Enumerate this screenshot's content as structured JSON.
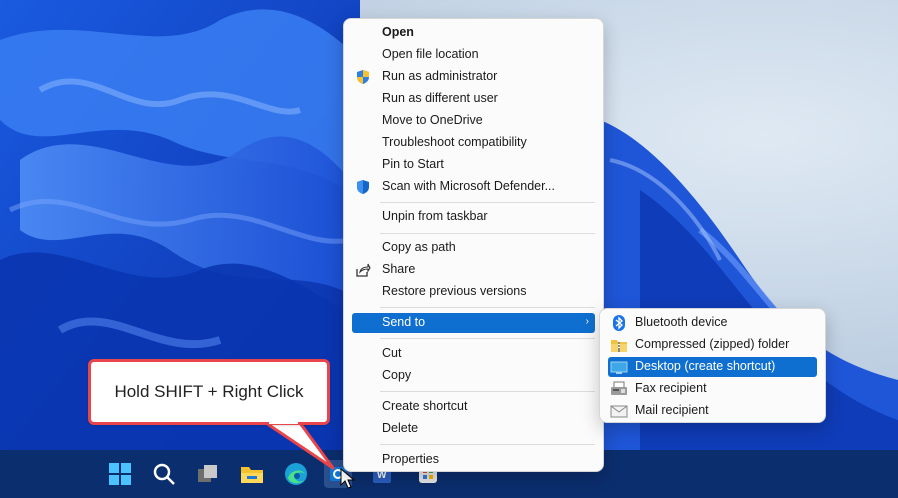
{
  "callout": {
    "text": "Hold SHIFT + Right Click"
  },
  "context_menu": {
    "items": [
      {
        "label": "Open",
        "icon": ""
      },
      {
        "label": "Open file location",
        "icon": ""
      },
      {
        "label": "Run as administrator",
        "icon": "uac-shield-icon"
      },
      {
        "label": "Run as different user",
        "icon": ""
      },
      {
        "label": "Move to OneDrive",
        "icon": ""
      },
      {
        "label": "Troubleshoot compatibility",
        "icon": ""
      },
      {
        "label": "Pin to Start",
        "icon": ""
      },
      {
        "label": "Scan with Microsoft Defender...",
        "icon": "defender-shield-icon"
      },
      {
        "label": "Unpin from taskbar",
        "icon": ""
      },
      {
        "label": "Copy as path",
        "icon": ""
      },
      {
        "label": "Share",
        "icon": "share-icon"
      },
      {
        "label": "Restore previous versions",
        "icon": ""
      },
      {
        "label": "Send to",
        "icon": "",
        "submenu": true
      },
      {
        "label": "Cut",
        "icon": ""
      },
      {
        "label": "Copy",
        "icon": ""
      },
      {
        "label": "Create shortcut",
        "icon": ""
      },
      {
        "label": "Delete",
        "icon": ""
      },
      {
        "label": "Properties",
        "icon": ""
      }
    ],
    "submenu_arrow": "›"
  },
  "send_to_menu": {
    "items": [
      {
        "label": "Bluetooth device",
        "icon": "bluetooth-icon"
      },
      {
        "label": "Compressed (zipped) folder",
        "icon": "zip-folder-icon"
      },
      {
        "label": "Desktop (create shortcut)",
        "icon": "desktop-icon"
      },
      {
        "label": "Fax recipient",
        "icon": "fax-icon"
      },
      {
        "label": "Mail recipient",
        "icon": "mail-icon"
      }
    ]
  },
  "taskbar": {
    "icons": [
      "start-icon",
      "search-icon",
      "task-view-icon",
      "file-explorer-icon",
      "edge-icon",
      "outlook-icon",
      "word-icon",
      "app-icon"
    ]
  },
  "colors": {
    "selection": "#0f6fd0",
    "taskbar": "#0b2e6e",
    "callout_border": "#e8464a"
  }
}
